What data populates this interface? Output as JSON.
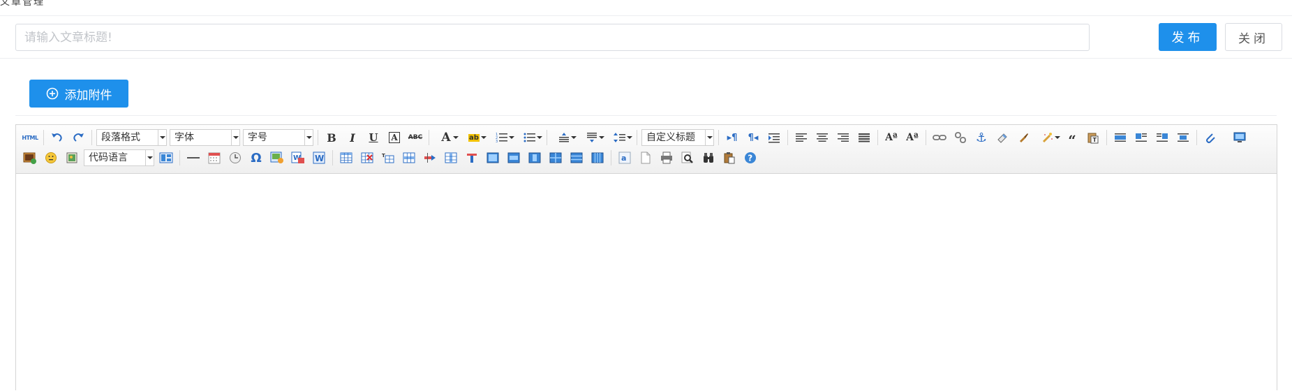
{
  "header": {
    "cut_text": "文章管理"
  },
  "title_row": {
    "placeholder": "请输入文章标题!",
    "publish_label": "发布",
    "close_label": "关闭"
  },
  "attach": {
    "label": "添加附件"
  },
  "toolbar": {
    "html_label": "HTML",
    "paragraph_label": "段落格式",
    "font_family_label": "字体",
    "font_size_label": "字号",
    "custom_title_label": "自定义标题",
    "code_lang_label": "代码语言",
    "row1_icons": [
      "source-icon",
      "undo-icon",
      "redo-icon",
      "bold-icon",
      "italic-icon",
      "underline-icon",
      "font-border-icon",
      "strikethrough-icon",
      "font-color-icon",
      "highlight-icon",
      "ordered-list-icon",
      "unordered-list-icon",
      "row-spacing-top-icon",
      "row-spacing-bottom-icon",
      "line-height-icon",
      "ltr-icon",
      "rtl-icon",
      "indent-icon",
      "align-left-icon",
      "align-center-icon",
      "align-right-icon",
      "align-justify-icon",
      "case-upper-icon",
      "case-lower-icon",
      "link-icon",
      "unlink-icon",
      "anchor-icon",
      "eraser-icon",
      "format-brush-icon",
      "auto-format-icon",
      "blockquote-icon",
      "paste-plain-icon",
      "image-none-icon",
      "image-left-icon",
      "image-right-icon",
      "image-center-icon",
      "attachment-icon",
      "preview-icon"
    ],
    "row2_icons": [
      "insert-image-icon",
      "emotion-icon",
      "scrawl-icon",
      "insert-code-icon",
      "template-icon",
      "horizontal-rule-icon",
      "date-icon",
      "time-icon",
      "special-char-icon",
      "word-image-icon",
      "wordimage-icon",
      "word-icon",
      "table-icon",
      "delete-table-icon",
      "insert-caption-icon",
      "insert-row-icon",
      "delete-row-icon",
      "insert-col-icon",
      "delete-col-icon",
      "merge-cells-icon",
      "merge-right-icon",
      "merge-down-icon",
      "split-cells-icon",
      "split-rows-icon",
      "split-cols-icon",
      "char-count-icon",
      "page-break-icon",
      "print-icon",
      "preview-search-icon",
      "search-replace-icon",
      "drafts-icon",
      "help-icon"
    ],
    "colors": {
      "accent": "#1e90eb",
      "blue_icon": "#2b6cc4"
    }
  }
}
